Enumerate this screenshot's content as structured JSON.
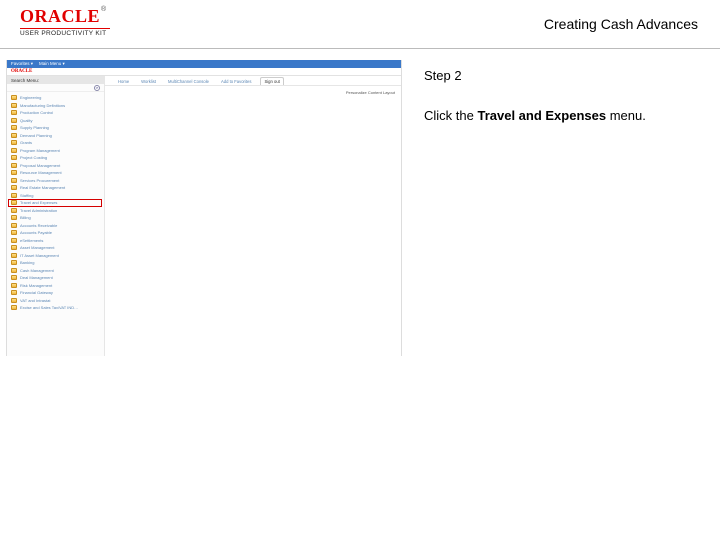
{
  "header": {
    "brand": "ORACLE",
    "tm": "®",
    "subtitle": "USER PRODUCTIVITY KIT",
    "doc_title": "Creating Cash Advances"
  },
  "instruction": {
    "step_label": "Step 2",
    "pre": "Click the ",
    "bold": "Travel and Expenses",
    "post": " menu."
  },
  "screenshot": {
    "topbar_left": "Favorites ▾",
    "topbar_mid": "Main Menu ▾",
    "search_label": "Search Menu:",
    "refresh_icon": "⟳",
    "tabs": [
      "Home",
      "Worklist",
      "MultiChannel Console",
      "Add to Favorites",
      "Sign out"
    ],
    "personalize": "Personalize Content  Layout",
    "menu": [
      "Engineering",
      "Manufacturing Definitions",
      "Production Control",
      "Quality",
      "Supply Planning",
      "Demand Planning",
      "Grants",
      "Program Management",
      "Project Costing",
      "Proposal Management",
      "Resource Management",
      "Services Procurement",
      "Real Estate Management",
      "Staffing",
      "Travel and Expenses",
      "Travel Administration",
      "Billing",
      "Accounts Receivable",
      "Accounts Payable",
      "eSettlements",
      "Asset Management",
      "IT Asset Management",
      "Banking",
      "Cash Management",
      "Deal Management",
      "Risk Management",
      "Financial Gateway",
      "VAT and Intrastat",
      "Excise and Sales Tax/VAT IND…"
    ],
    "highlight_index": 14
  }
}
